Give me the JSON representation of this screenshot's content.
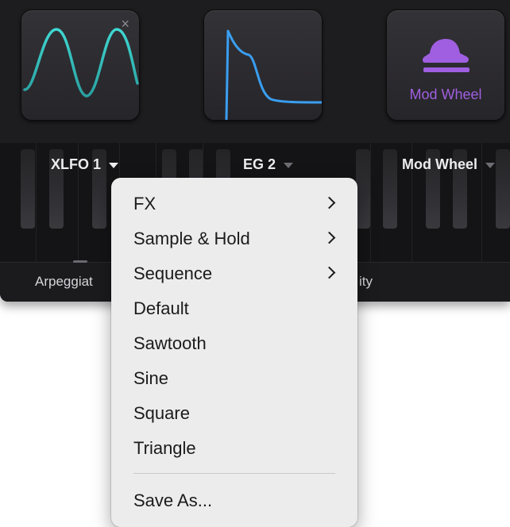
{
  "modules": [
    {
      "name": "XLFO 1",
      "wave_color": "#3fd8d2",
      "show_close": true,
      "close_glyph": "×"
    },
    {
      "name": "EG 2",
      "wave_color": "#3a9ef0"
    },
    {
      "name": "Mod Wheel",
      "tile_label": "Mod Wheel",
      "accent_color": "#9f5fe0"
    }
  ],
  "bottom_bar": {
    "left_text": "Arpeggiat",
    "right_text": "ity"
  },
  "context_menu": {
    "items": [
      {
        "label": "FX",
        "submenu": true
      },
      {
        "label": "Sample & Hold",
        "submenu": true
      },
      {
        "label": "Sequence",
        "submenu": true
      },
      {
        "label": "Default",
        "submenu": false
      },
      {
        "label": "Sawtooth",
        "submenu": false
      },
      {
        "label": "Sine",
        "submenu": false
      },
      {
        "label": "Square",
        "submenu": false
      },
      {
        "label": "Triangle",
        "submenu": false
      }
    ],
    "footer_item": {
      "label": "Save As..."
    }
  }
}
